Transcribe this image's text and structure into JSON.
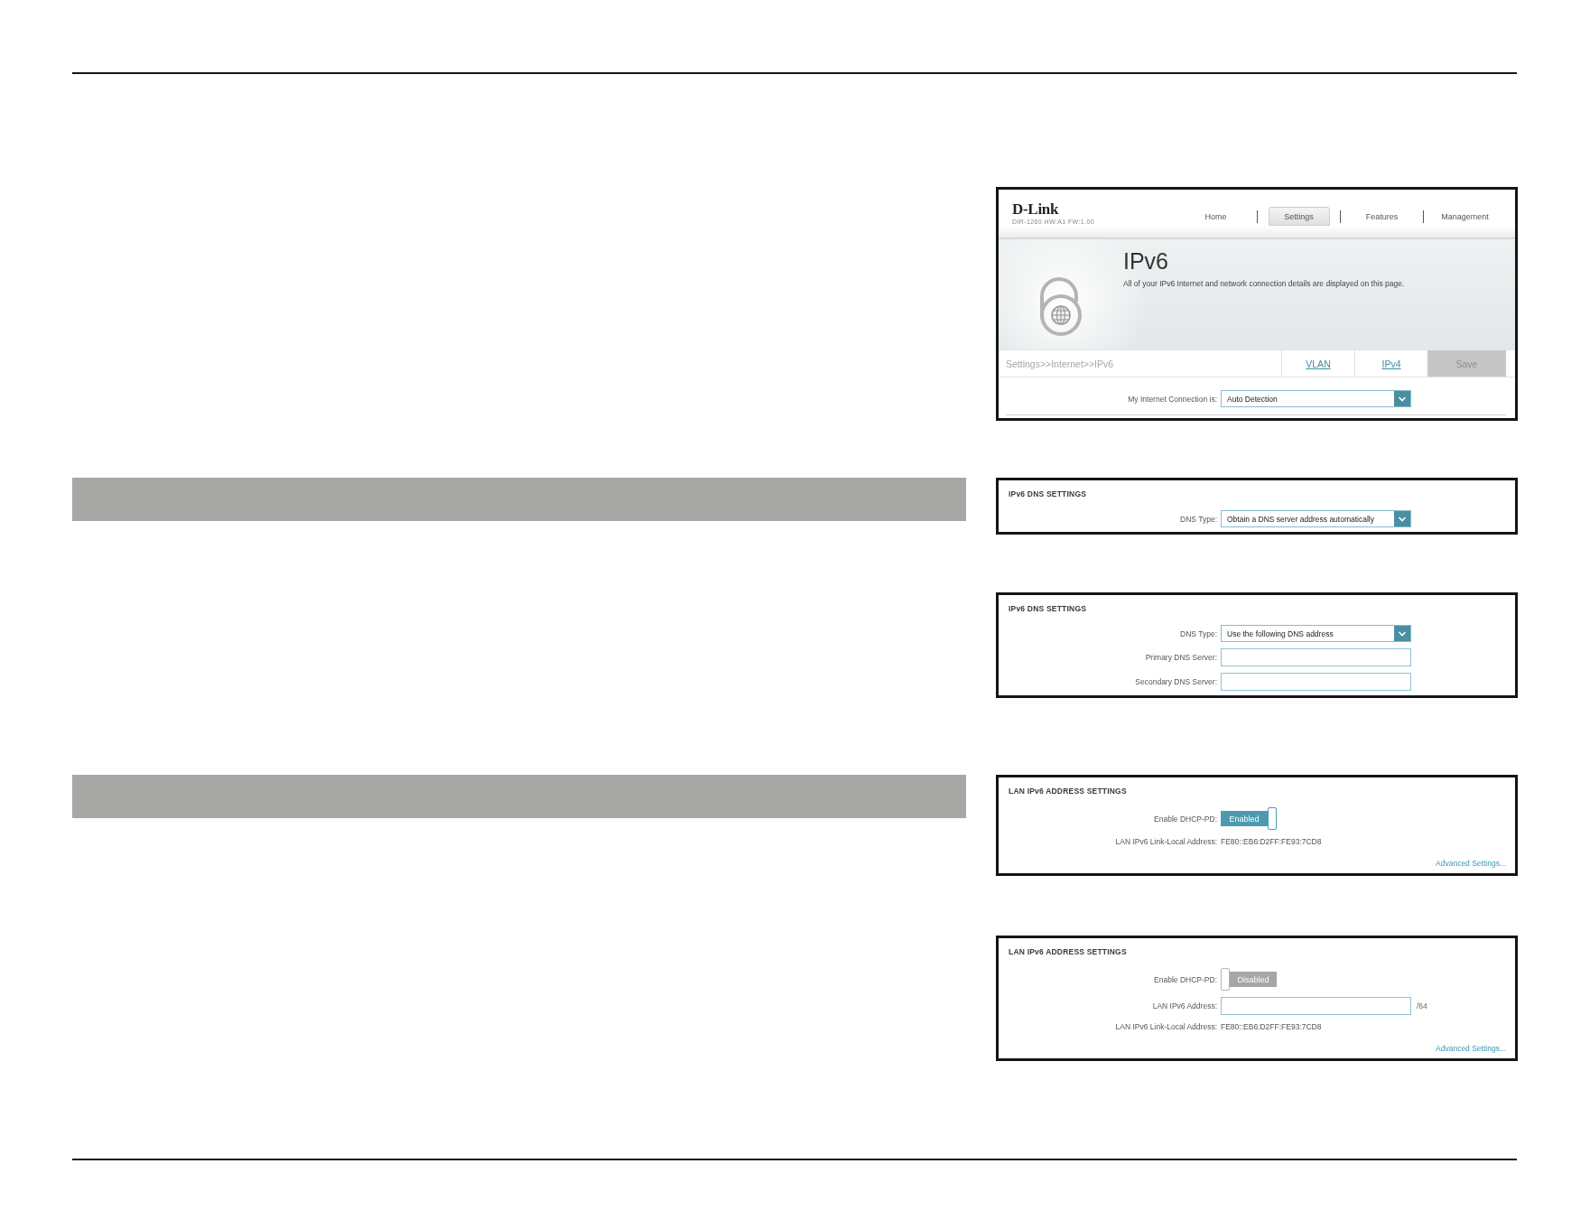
{
  "sections": [
    {
      "header_bar": false,
      "screenshot": {
        "kind": "router_page",
        "logo": "D-Link",
        "model": "DIR-1260 HW:A1 FW:1.00",
        "nav": [
          {
            "label": "Home",
            "selected": false
          },
          {
            "label": "Settings",
            "selected": true
          },
          {
            "label": "Features",
            "selected": false
          },
          {
            "label": "Management",
            "selected": false
          }
        ],
        "title": "IPv6",
        "description": "All of your IPv6 Internet and network connection details are displayed on this page.",
        "breadcrumb": "Settings>>Internet>>IPv6",
        "actions": [
          {
            "kind": "link",
            "label": "VLAN"
          },
          {
            "kind": "link",
            "label": "IPv4"
          },
          {
            "kind": "save",
            "label": "Save"
          }
        ],
        "fields": [
          {
            "kind": "select",
            "label": "My Internet Connection is:",
            "value": "Auto Detection"
          }
        ]
      }
    },
    {
      "header_bar": true,
      "screenshot": {
        "kind": "settings_panel",
        "heading": "IPv6 DNS SETTINGS",
        "fields": [
          {
            "kind": "select",
            "label": "DNS Type:",
            "value": "Obtain a DNS server address automatically"
          }
        ]
      }
    },
    {
      "header_bar": false,
      "screenshot": {
        "kind": "settings_panel",
        "heading": "IPv6 DNS SETTINGS",
        "fields": [
          {
            "kind": "select",
            "label": "DNS Type:",
            "value": "Use the following DNS address"
          },
          {
            "kind": "input",
            "label": "Primary DNS Server:"
          },
          {
            "kind": "input",
            "label": "Secondary DNS Server:"
          }
        ]
      }
    },
    {
      "header_bar": true,
      "screenshot": {
        "kind": "settings_panel",
        "heading": "LAN IPv6 ADDRESS SETTINGS",
        "fields": [
          {
            "kind": "toggle",
            "label": "Enable DHCP-PD:",
            "value": "Enabled",
            "on": true
          },
          {
            "kind": "text",
            "label": "LAN IPv6 Link-Local Address:",
            "value": "FE80::EB6:D2FF:FE93:7CD8"
          }
        ],
        "link": "Advanced Settings..."
      }
    },
    {
      "header_bar": false,
      "screenshot": {
        "kind": "settings_panel",
        "heading": "LAN IPv6 ADDRESS SETTINGS",
        "fields": [
          {
            "kind": "toggle",
            "label": "Enable DHCP-PD:",
            "value": "Disabled",
            "on": false
          },
          {
            "kind": "input",
            "label": "LAN IPv6 Address:",
            "suffix": "/64"
          },
          {
            "kind": "text",
            "label": "LAN IPv6 Link-Local Address:",
            "value": "FE80::EB6:D2FF:FE93:7CD8"
          }
        ],
        "link": "Advanced Settings..."
      }
    }
  ]
}
